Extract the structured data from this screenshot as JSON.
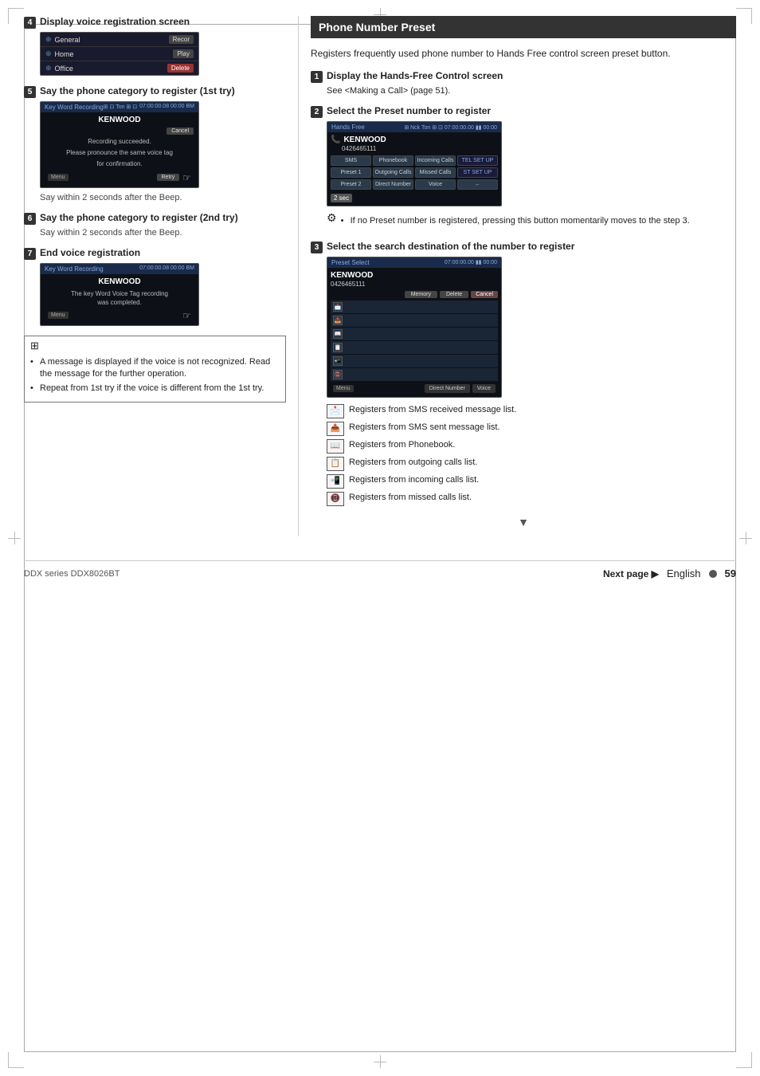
{
  "page": {
    "title": "DDX series DDX8026BT",
    "page_number": "59",
    "language": "English",
    "footer_next": "Next page ▶"
  },
  "left_column": {
    "steps": [
      {
        "number": "4",
        "title": "Display voice registration screen",
        "screen": {
          "items": [
            {
              "icon": "⊕",
              "label": "General",
              "btn": "Recor"
            },
            {
              "icon": "⊕",
              "label": "Home",
              "btn": "Play"
            },
            {
              "icon": "⊕",
              "label": "Office",
              "btn": "Delete"
            }
          ]
        }
      },
      {
        "number": "5",
        "title": "Say the phone category to register (1st try)",
        "screen": {
          "header_left": "Key Word Recording",
          "header_right": "07:00:00.08  00:00 BM",
          "brand": "KENWOOD",
          "message1": "Recording succeeded.",
          "message2": "Please pronounce the same voice tag",
          "message3": "for confirmation.",
          "cancel_btn": "Cancel",
          "retry_btn": "Retry"
        },
        "say_text": "Say within 2 seconds after the Beep."
      },
      {
        "number": "6",
        "title": "Say the phone category to register (2nd try)",
        "say_text": "Say within 2 seconds after the Beep."
      },
      {
        "number": "7",
        "title": "End voice registration",
        "screen": {
          "header_left": "Key Word Recording",
          "header_right": "07:00:00.08  00:00 BM",
          "brand": "KENWOOD",
          "message": "The key Word Voice Tag recording\nwas completed."
        }
      }
    ],
    "note": {
      "bullets": [
        "A message is displayed if the voice is not recognized. Read the message for the further operation.",
        "Repeat from 1st try if the voice is different from the 1st try."
      ]
    }
  },
  "right_column": {
    "section_title": "Phone Number Preset",
    "intro": "Registers frequently used phone number to Hands Free control screen preset button.",
    "steps": [
      {
        "number": "1",
        "title": "Display the Hands-Free Control screen",
        "body": "See <Making a Call> (page 51)."
      },
      {
        "number": "2",
        "title": "Select the Preset number to register",
        "screen": {
          "header_left": "Hands Free",
          "header_right": "07:00:00.00  00:00 BM",
          "brand": "KENWOOD",
          "number": "0426465111",
          "buttons": [
            {
              "label": "SMS",
              "type": "normal"
            },
            {
              "label": "⊞⊞",
              "type": "normal"
            },
            {
              "label": "📞",
              "type": "normal"
            },
            {
              "label": "TEL SET UP",
              "type": "setup"
            },
            {
              "label": "Preset 1",
              "type": "normal"
            },
            {
              "label": "Outgoing Calls",
              "type": "normal"
            },
            {
              "label": "Missed Calls",
              "type": "normal"
            },
            {
              "label": "ST SET UP",
              "type": "setup"
            },
            {
              "label": "Preset 2",
              "type": "normal"
            },
            {
              "label": "Direct Number",
              "type": "normal"
            },
            {
              "label": "Voice",
              "type": "normal"
            },
            {
              "label": "←",
              "type": "normal"
            }
          ],
          "timer": "2 sec"
        },
        "note": "If no Preset number is registered, pressing this button momentarily moves to the step 3."
      },
      {
        "number": "3",
        "title": "Select the search destination of the number to register",
        "screen": {
          "header_left": "Preset Select",
          "header_right": "07:00:00.00  00:00 BM",
          "brand": "KENWOOD",
          "number": "0426465111",
          "memory_btn": "Memory",
          "delete_btn": "Delete",
          "cancel_btn": "Cancel",
          "icons": [
            "⊠",
            "⊠",
            "⊞",
            "⊡",
            "⊡",
            "⊡"
          ],
          "bottom_btns": [
            "Direct Number",
            "Voice"
          ]
        },
        "icon_list": [
          {
            "icon": "📩",
            "label": "Registers from SMS received message list."
          },
          {
            "icon": "📤",
            "label": "Registers from SMS sent message list."
          },
          {
            "icon": "📖",
            "label": "Registers from Phonebook."
          },
          {
            "icon": "📋",
            "label": "Registers from outgoing calls list."
          },
          {
            "icon": "📲",
            "label": "Registers from incoming calls list."
          },
          {
            "icon": "📵",
            "label": "Registers from missed calls list."
          }
        ]
      }
    ]
  }
}
